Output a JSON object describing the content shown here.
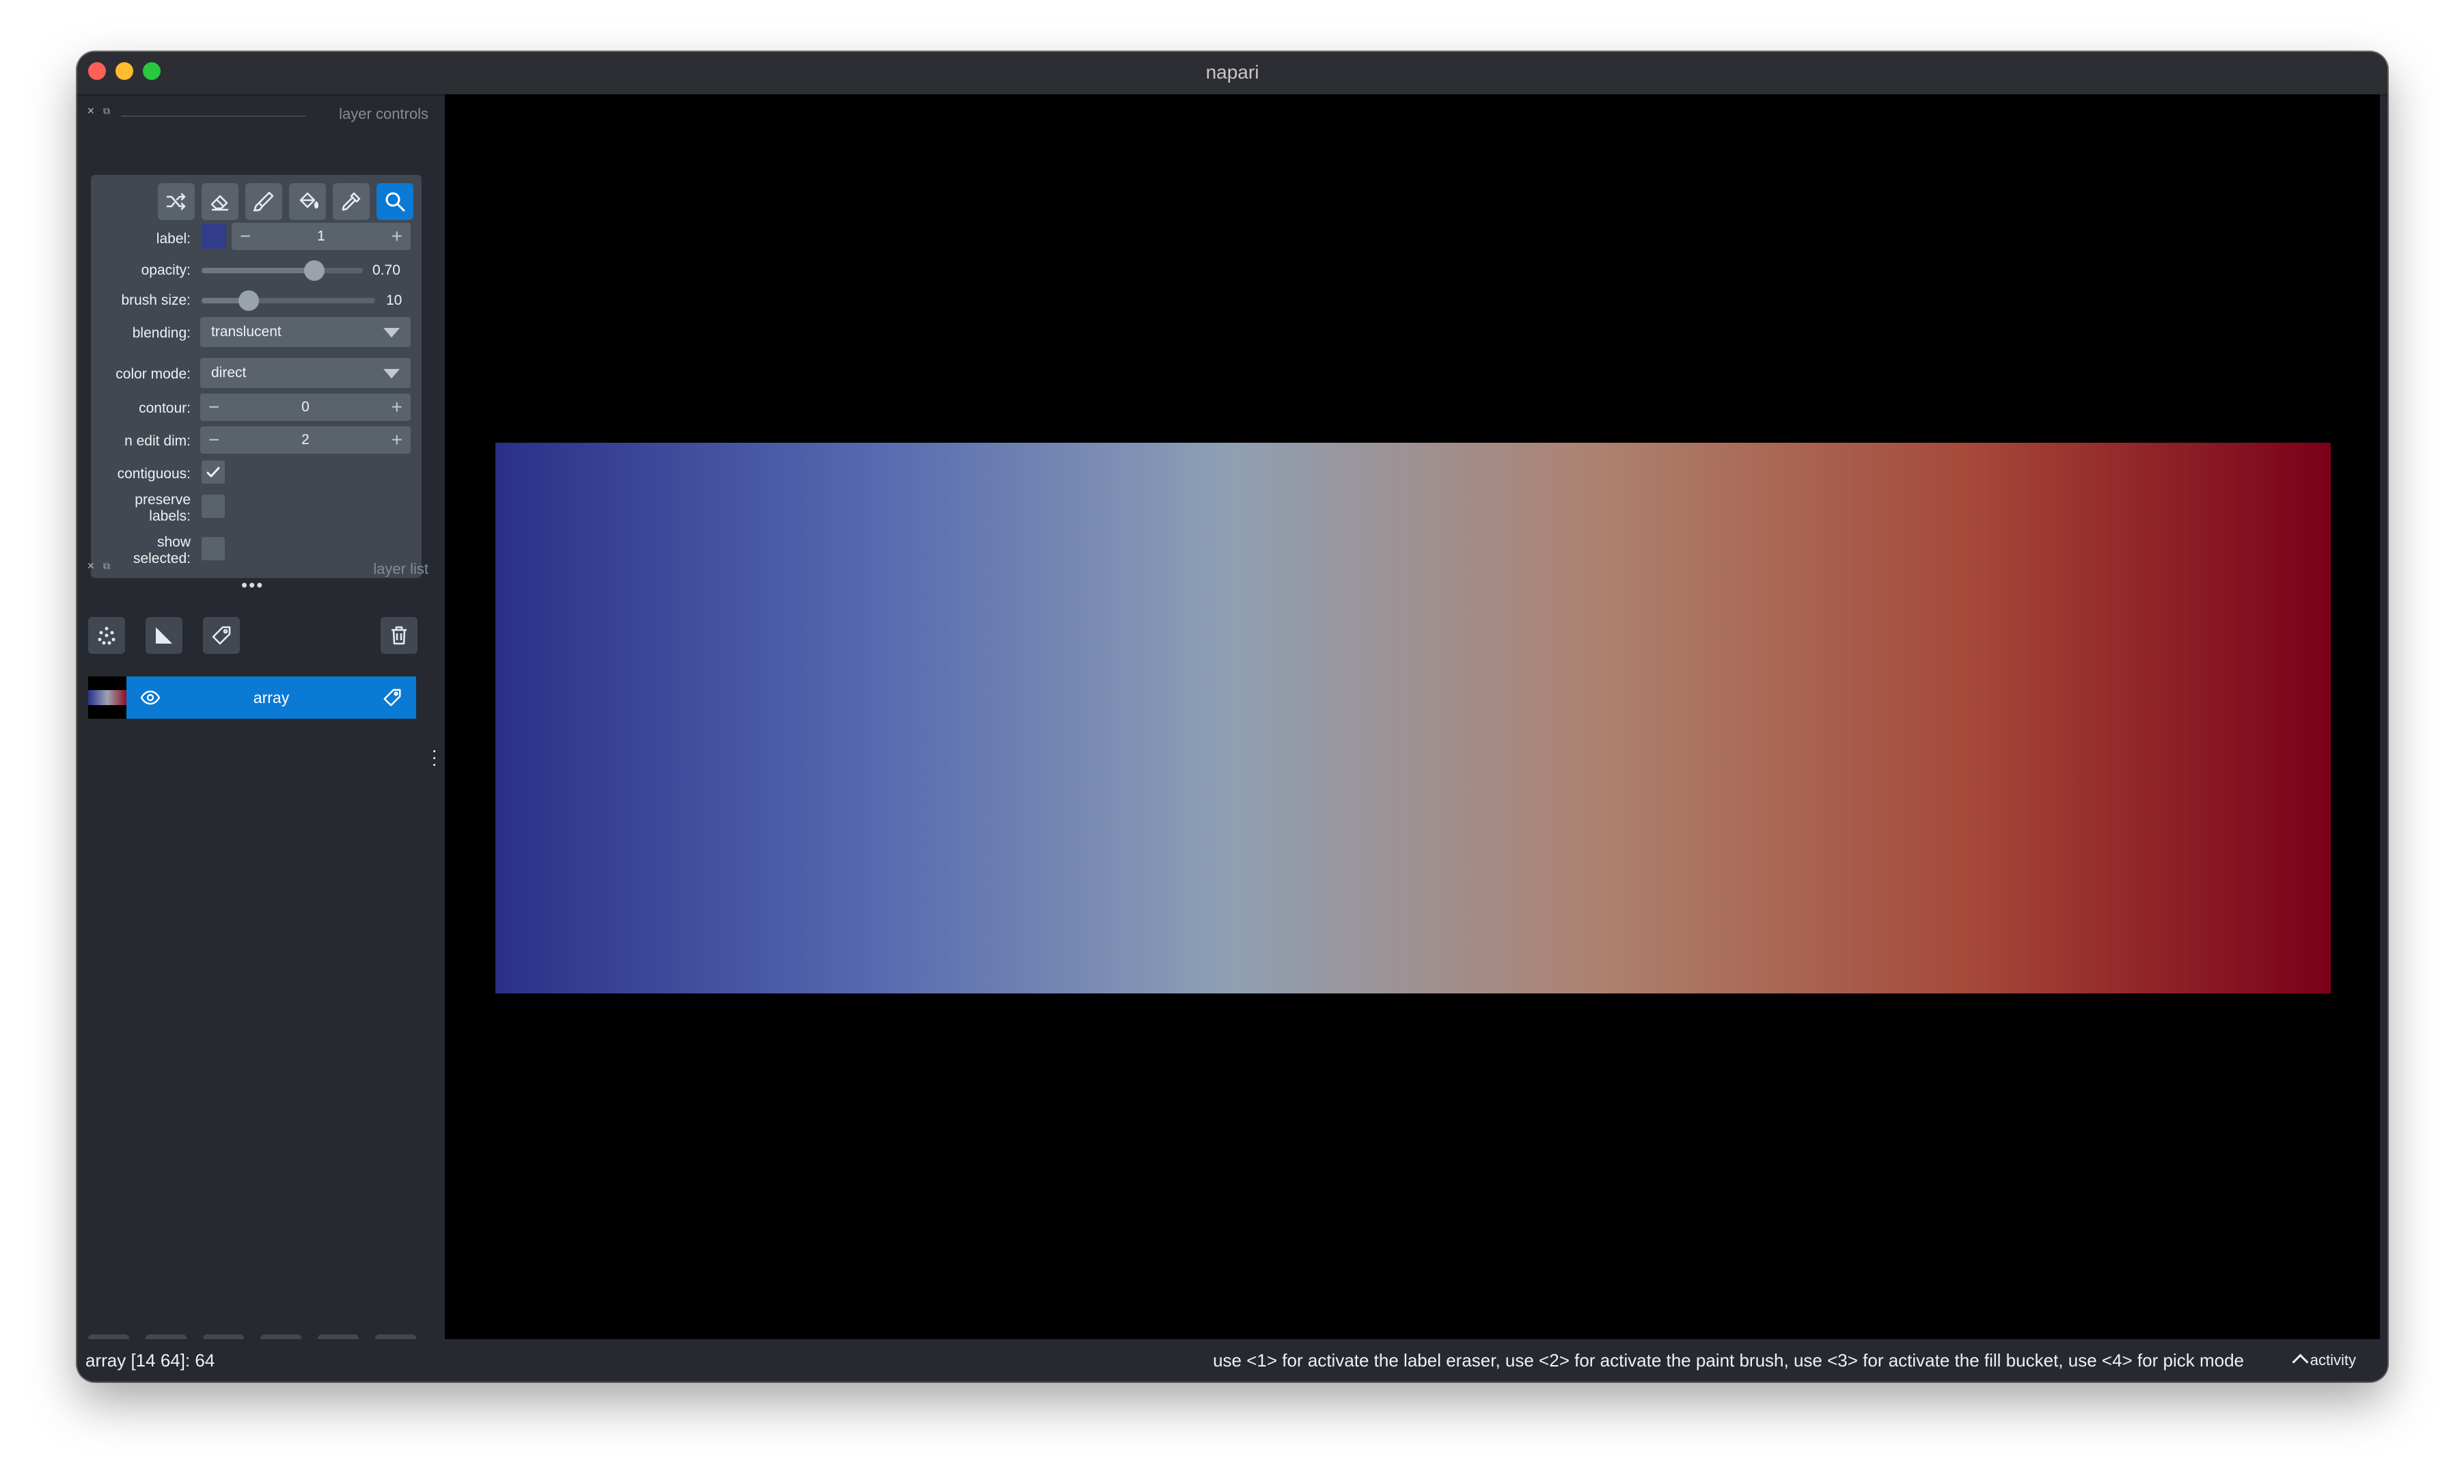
{
  "window": {
    "title": "napari"
  },
  "layer_controls": {
    "header": "layer controls",
    "label_label": "label:",
    "label_value": "1",
    "label_swatch_color": "#323c8c",
    "opacity_label": "opacity:",
    "opacity_value": "0.70",
    "opacity_fraction": 0.7,
    "brush_label": "brush size:",
    "brush_value": "10",
    "brush_fraction": 0.27,
    "blending_label": "blending:",
    "blending_value": "translucent",
    "color_mode_label": "color mode:",
    "color_mode_value": "direct",
    "contour_label": "contour:",
    "contour_value": "0",
    "n_edit_dim_label": "n edit dim:",
    "n_edit_dim_value": "2",
    "contiguous_label": "contiguous:",
    "contiguous_checked": true,
    "preserve_label_1": "preserve",
    "preserve_label_2": "labels:",
    "preserve_checked": false,
    "show_selected_1": "show",
    "show_selected_2": "selected:",
    "show_selected_checked": false,
    "tools": [
      "shuffle-icon",
      "eraser-icon",
      "paint-brush-icon",
      "fill-bucket-icon",
      "color-picker-icon",
      "zoom-icon"
    ],
    "active_tool": "zoom-icon"
  },
  "layer_list": {
    "header": "layer list",
    "layers": [
      {
        "name": "array",
        "visible": true,
        "selected": true
      }
    ]
  },
  "canvas": {
    "background": "#000000",
    "gradient_colors": [
      "#2a3088",
      "#5468b0",
      "#8fa0b4",
      "#ad8270",
      "#a64a3a",
      "#7a0018"
    ]
  },
  "status": {
    "left": "array [14 64]: 64",
    "right": "use <1> for activate the label eraser, use <2> for activate the paint brush, use <3> for activate the fill bucket, use <4> for pick mode",
    "activity": "activity"
  }
}
